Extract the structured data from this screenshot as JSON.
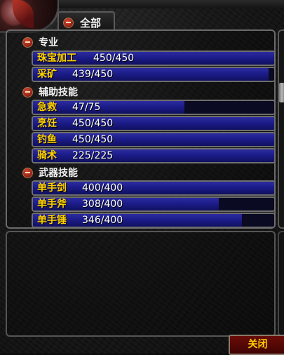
{
  "tab": {
    "label": "全部"
  },
  "categories": [
    {
      "name": "专业",
      "skills": [
        {
          "name": "珠宝加工",
          "value": "450/450",
          "progress": 1.0
        },
        {
          "name": "采矿",
          "value": "439/450",
          "progress": 0.976
        }
      ]
    },
    {
      "name": "辅助技能",
      "skills": [
        {
          "name": "急救",
          "value": "47/75",
          "progress": 0.627
        },
        {
          "name": "烹饪",
          "value": "450/450",
          "progress": 1.0
        },
        {
          "name": "钓鱼",
          "value": "450/450",
          "progress": 1.0
        },
        {
          "name": "骑术",
          "value": "225/225",
          "progress": 1.0
        }
      ]
    },
    {
      "name": "武器技能",
      "skills": [
        {
          "name": "单手剑",
          "value": "400/400",
          "progress": 1.0
        },
        {
          "name": "单手斧",
          "value": "308/400",
          "progress": 0.77
        },
        {
          "name": "单手锤",
          "value": "346/400",
          "progress": 0.865
        }
      ]
    }
  ],
  "close_button": {
    "label": "关闭"
  },
  "colors": {
    "skill_name": "#ffd200",
    "bar_fill": "#1c1c8a",
    "close_bg": "#5a0806"
  }
}
